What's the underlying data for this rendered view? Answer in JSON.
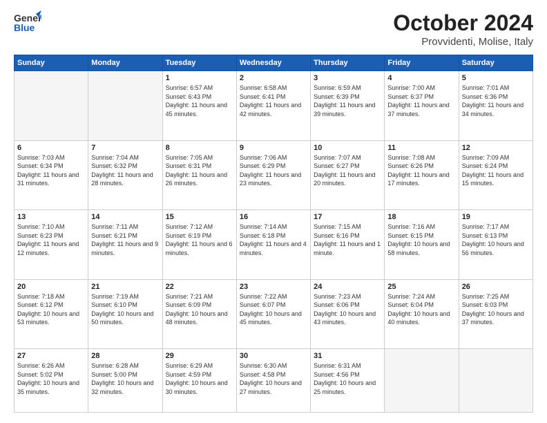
{
  "header": {
    "logo_general": "General",
    "logo_blue": "Blue",
    "title": "October 2024",
    "subtitle": "Provvidenti, Molise, Italy"
  },
  "weekdays": [
    "Sunday",
    "Monday",
    "Tuesday",
    "Wednesday",
    "Thursday",
    "Friday",
    "Saturday"
  ],
  "weeks": [
    [
      {
        "day": "",
        "info": ""
      },
      {
        "day": "",
        "info": ""
      },
      {
        "day": "1",
        "info": "Sunrise: 6:57 AM\nSunset: 6:43 PM\nDaylight: 11 hours and 45 minutes."
      },
      {
        "day": "2",
        "info": "Sunrise: 6:58 AM\nSunset: 6:41 PM\nDaylight: 11 hours and 42 minutes."
      },
      {
        "day": "3",
        "info": "Sunrise: 6:59 AM\nSunset: 6:39 PM\nDaylight: 11 hours and 39 minutes."
      },
      {
        "day": "4",
        "info": "Sunrise: 7:00 AM\nSunset: 6:37 PM\nDaylight: 11 hours and 37 minutes."
      },
      {
        "day": "5",
        "info": "Sunrise: 7:01 AM\nSunset: 6:36 PM\nDaylight: 11 hours and 34 minutes."
      }
    ],
    [
      {
        "day": "6",
        "info": "Sunrise: 7:03 AM\nSunset: 6:34 PM\nDaylight: 11 hours and 31 minutes."
      },
      {
        "day": "7",
        "info": "Sunrise: 7:04 AM\nSunset: 6:32 PM\nDaylight: 11 hours and 28 minutes."
      },
      {
        "day": "8",
        "info": "Sunrise: 7:05 AM\nSunset: 6:31 PM\nDaylight: 11 hours and 26 minutes."
      },
      {
        "day": "9",
        "info": "Sunrise: 7:06 AM\nSunset: 6:29 PM\nDaylight: 11 hours and 23 minutes."
      },
      {
        "day": "10",
        "info": "Sunrise: 7:07 AM\nSunset: 6:27 PM\nDaylight: 11 hours and 20 minutes."
      },
      {
        "day": "11",
        "info": "Sunrise: 7:08 AM\nSunset: 6:26 PM\nDaylight: 11 hours and 17 minutes."
      },
      {
        "day": "12",
        "info": "Sunrise: 7:09 AM\nSunset: 6:24 PM\nDaylight: 11 hours and 15 minutes."
      }
    ],
    [
      {
        "day": "13",
        "info": "Sunrise: 7:10 AM\nSunset: 6:23 PM\nDaylight: 11 hours and 12 minutes."
      },
      {
        "day": "14",
        "info": "Sunrise: 7:11 AM\nSunset: 6:21 PM\nDaylight: 11 hours and 9 minutes."
      },
      {
        "day": "15",
        "info": "Sunrise: 7:12 AM\nSunset: 6:19 PM\nDaylight: 11 hours and 6 minutes."
      },
      {
        "day": "16",
        "info": "Sunrise: 7:14 AM\nSunset: 6:18 PM\nDaylight: 11 hours and 4 minutes."
      },
      {
        "day": "17",
        "info": "Sunrise: 7:15 AM\nSunset: 6:16 PM\nDaylight: 11 hours and 1 minute."
      },
      {
        "day": "18",
        "info": "Sunrise: 7:16 AM\nSunset: 6:15 PM\nDaylight: 10 hours and 58 minutes."
      },
      {
        "day": "19",
        "info": "Sunrise: 7:17 AM\nSunset: 6:13 PM\nDaylight: 10 hours and 56 minutes."
      }
    ],
    [
      {
        "day": "20",
        "info": "Sunrise: 7:18 AM\nSunset: 6:12 PM\nDaylight: 10 hours and 53 minutes."
      },
      {
        "day": "21",
        "info": "Sunrise: 7:19 AM\nSunset: 6:10 PM\nDaylight: 10 hours and 50 minutes."
      },
      {
        "day": "22",
        "info": "Sunrise: 7:21 AM\nSunset: 6:09 PM\nDaylight: 10 hours and 48 minutes."
      },
      {
        "day": "23",
        "info": "Sunrise: 7:22 AM\nSunset: 6:07 PM\nDaylight: 10 hours and 45 minutes."
      },
      {
        "day": "24",
        "info": "Sunrise: 7:23 AM\nSunset: 6:06 PM\nDaylight: 10 hours and 43 minutes."
      },
      {
        "day": "25",
        "info": "Sunrise: 7:24 AM\nSunset: 6:04 PM\nDaylight: 10 hours and 40 minutes."
      },
      {
        "day": "26",
        "info": "Sunrise: 7:25 AM\nSunset: 6:03 PM\nDaylight: 10 hours and 37 minutes."
      }
    ],
    [
      {
        "day": "27",
        "info": "Sunrise: 6:26 AM\nSunset: 5:02 PM\nDaylight: 10 hours and 35 minutes."
      },
      {
        "day": "28",
        "info": "Sunrise: 6:28 AM\nSunset: 5:00 PM\nDaylight: 10 hours and 32 minutes."
      },
      {
        "day": "29",
        "info": "Sunrise: 6:29 AM\nSunset: 4:59 PM\nDaylight: 10 hours and 30 minutes."
      },
      {
        "day": "30",
        "info": "Sunrise: 6:30 AM\nSunset: 4:58 PM\nDaylight: 10 hours and 27 minutes."
      },
      {
        "day": "31",
        "info": "Sunrise: 6:31 AM\nSunset: 4:56 PM\nDaylight: 10 hours and 25 minutes."
      },
      {
        "day": "",
        "info": ""
      },
      {
        "day": "",
        "info": ""
      }
    ]
  ]
}
